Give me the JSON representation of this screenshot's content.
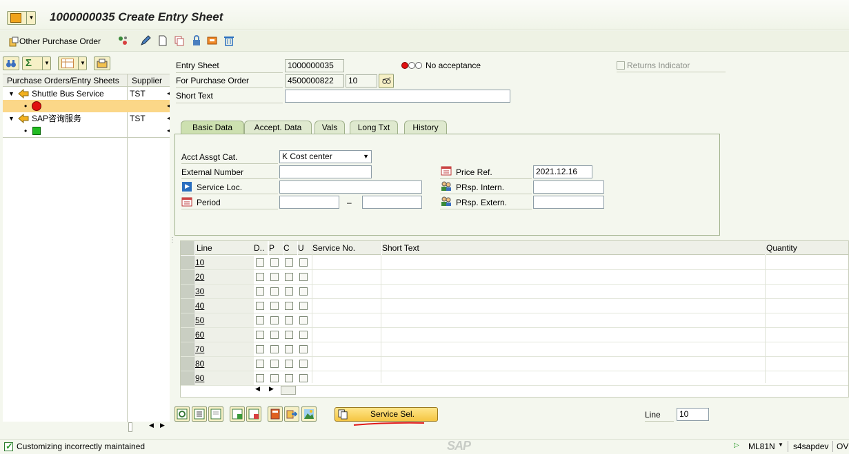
{
  "window": {
    "title": "1000000035 Create Entry Sheet"
  },
  "toolbar": {
    "other_po_label": "Other Purchase Order"
  },
  "tree": {
    "col_po": "Purchase Orders/Entry Sheets",
    "col_supplier": "Supplier",
    "items": [
      {
        "label": "Shuttle Bus Service",
        "supplier": "TST",
        "status_color": "#e01010"
      },
      {
        "label": "SAP咨询服务",
        "supplier": "TST",
        "status_color": "#22bb22"
      }
    ]
  },
  "header": {
    "entry_sheet_label": "Entry Sheet",
    "entry_sheet_value": "1000000035",
    "po_label": "For Purchase Order",
    "po_value": "4500000822",
    "po_item": "10",
    "short_text_label": "Short Text",
    "short_text_value": "",
    "acceptance_text": "No acceptance",
    "returns_label": "Returns Indicator"
  },
  "tabs": [
    "Basic Data",
    "Accept. Data",
    "Vals",
    "Long Txt",
    "History"
  ],
  "basic": {
    "acct_label": "Acct Assgt Cat.",
    "acct_value": "K Cost center",
    "ext_num_label": "External Number",
    "service_loc_label": "Service Loc.",
    "period_label": "Period",
    "period_sep": "–",
    "price_ref_label": "Price Ref.",
    "price_ref_value": "2021.12.16",
    "prsp_intern_label": "PRsp. Intern.",
    "prsp_extern_label": "PRsp. Extern."
  },
  "grid": {
    "headers": {
      "line": "Line",
      "d": "D..",
      "p": "P",
      "c": "C",
      "u": "U",
      "service_no": "Service No.",
      "short_text": "Short Text",
      "quantity": "Quantity"
    },
    "rows": [
      "10",
      "20",
      "30",
      "40",
      "50",
      "60",
      "70",
      "80",
      "90"
    ]
  },
  "bottom": {
    "service_sel_label": "Service Sel.",
    "line_label": "Line",
    "line_value": "10"
  },
  "status": {
    "message": "Customizing incorrectly maintained",
    "logo": "SAP",
    "transaction": "ML81N",
    "system": "s4sapdev",
    "mode": "OV"
  }
}
